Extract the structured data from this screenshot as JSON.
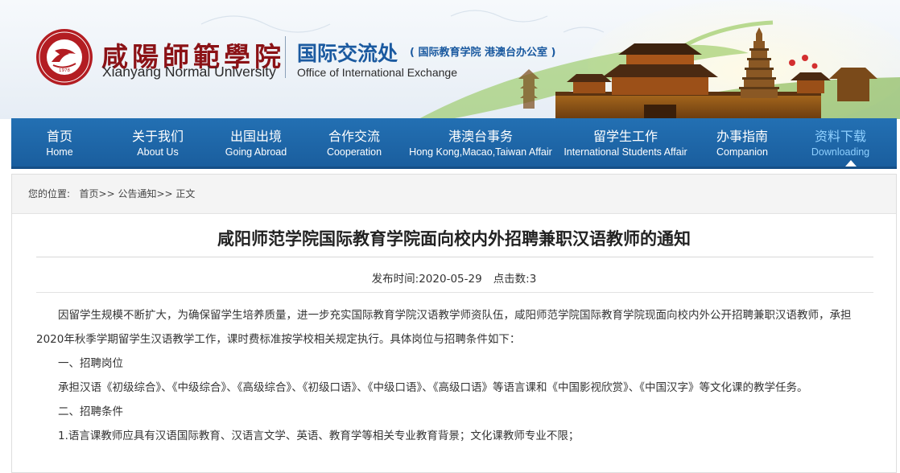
{
  "header": {
    "university_cn": "咸陽師範學院",
    "university_en": "Xianyang Normal University",
    "office_cn": "国际交流处",
    "office_note": "( 国际教育学院  港澳台办公室 )",
    "office_en": "Office of International Exchange",
    "seal_year": "1978"
  },
  "nav": {
    "items": [
      {
        "cn": "首页",
        "en": "Home"
      },
      {
        "cn": "关于我们",
        "en": "About Us"
      },
      {
        "cn": "出国出境",
        "en": "Going Abroad"
      },
      {
        "cn": "合作交流",
        "en": "Cooperation"
      },
      {
        "cn": "港澳台事务",
        "en": "Hong Kong,Macao,Taiwan Affair"
      },
      {
        "cn": "留学生工作",
        "en": "International Students Affair"
      },
      {
        "cn": "办事指南",
        "en": "Companion"
      },
      {
        "cn": "资料下载",
        "en": "Downloading"
      }
    ],
    "active_index": 7
  },
  "breadcrumb": {
    "prefix": "您的位置:",
    "home": "首页",
    "sep1": ">>",
    "notices": "公告通知",
    "sep2": ">>",
    "current": "正文"
  },
  "article": {
    "title": "咸阳师范学院国际教育学院面向校内外招聘兼职汉语教师的通知",
    "date_label": "发布时间:",
    "date": "2020-05-29",
    "clicks_label": "点击数:",
    "clicks": "3",
    "paragraphs": [
      "因留学生规模不断扩大，为确保留学生培养质量，进一步充实国际教育学院汉语教学师资队伍，咸阳师范学院国际教育学院现面向校内外公开招聘兼职汉语教师，承担2020年秋季学期留学生汉语教学工作，课时费标准按学校相关规定执行。具体岗位与招聘条件如下：",
      "一、招聘岗位",
      "承担汉语《初级综合》、《中级综合》、《高级综合》、《初级口语》、《中级口语》、《高级口语》等语言课和《中国影视欣赏》、《中国汉字》等文化课的教学任务。",
      "二、招聘条件",
      "1.语言课教师应具有汉语国际教育、汉语言文学、英语、教育学等相关专业教育背景；文化课教师专业不限；"
    ]
  },
  "colors": {
    "nav_bg": "#1d63a5",
    "nav_active_text": "#8fd0ff",
    "brand_red": "#8b1216",
    "office_blue": "#1b5aa0"
  }
}
